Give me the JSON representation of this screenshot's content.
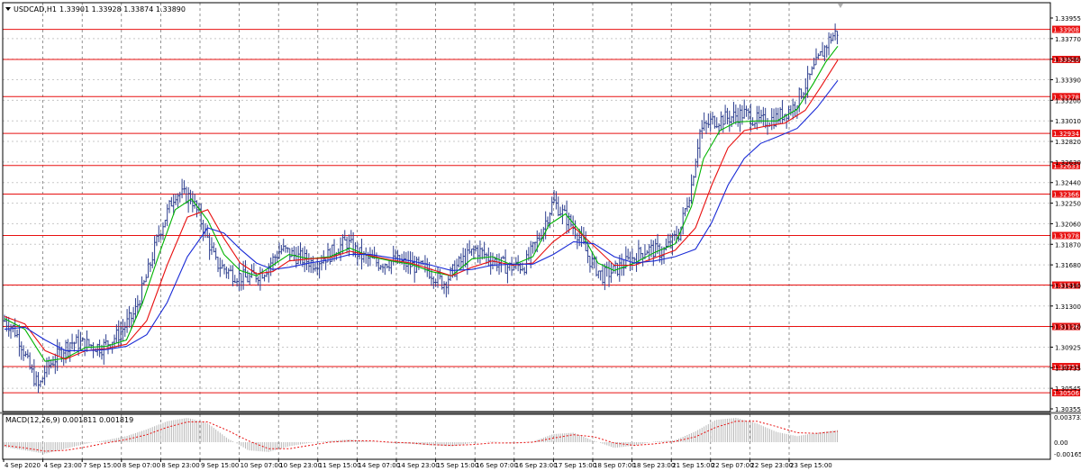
{
  "header": {
    "symbol_label": "USDCAD,H1",
    "ohlc_label": "1.33901 1.33928 1.33874 1.33890"
  },
  "macd": {
    "label": "MACD(12,26,9) 0.001811 0.001819",
    "scale_labels": [
      "0.003732",
      "0.00",
      "-0.001652"
    ]
  },
  "colors": {
    "background": "#ffffff",
    "frame": "#000000",
    "grid": "#c8c8c8",
    "candles": "#2e3f8f",
    "ma_fast": "#00b400",
    "ma_mid": "#e81010",
    "ma_slow": "#1a2bd6",
    "level_line": "#e81010",
    "level_tag_bg": "#e81010",
    "level_tag_text": "#ffffff",
    "macd_hist": "#b8b8b8",
    "macd_signal": "#e81010"
  },
  "chart_data": {
    "type": "line",
    "title": "USDCAD,H1",
    "y_ticks": [
      "1.33955",
      "1.33770",
      "1.33580",
      "1.33390",
      "1.33200",
      "1.33010",
      "1.32820",
      "1.32630",
      "1.32440",
      "1.32250",
      "1.32060",
      "1.31870",
      "1.31680",
      "1.31490",
      "1.31300",
      "1.31110",
      "1.30925",
      "1.30735",
      "1.30545",
      "1.30355"
    ],
    "x_ticks": [
      "4 Sep 2020",
      "4 Sep 23:00",
      "7 Sep 15:00",
      "8 Sep 07:00",
      "8 Sep 23:00",
      "9 Sep 15:00",
      "10 Sep 07:00",
      "10 Sep 23:00",
      "11 Sep 15:00",
      "14 Sep 07:00",
      "14 Sep 23:00",
      "15 Sep 15:00",
      "16 Sep 07:00",
      "16 Sep 23:00",
      "17 Sep 15:00",
      "18 Sep 07:00",
      "18 Sep 23:00",
      "21 Sep 15:00",
      "22 Sep 07:00",
      "22 Sep 23:00",
      "23 Sep 15:00"
    ],
    "ylim": [
      1.30355,
      1.33955
    ],
    "x_range": [
      0,
      20.5
    ],
    "grid": true,
    "levels": [
      "1.33908",
      "1.33626",
      "1.33278",
      "1.32934",
      "1.32633",
      "1.32366",
      "1.31978",
      "1.31514",
      "1.31126",
      "1.30751",
      "1.30506"
    ],
    "price_series": [
      {
        "x": 0.0,
        "y": 1.3118
      },
      {
        "x": 0.2,
        "y": 1.3112
      },
      {
        "x": 0.4,
        "y": 1.3098
      },
      {
        "x": 0.6,
        "y": 1.3075
      },
      {
        "x": 0.85,
        "y": 1.3055
      },
      {
        "x": 1.0,
        "y": 1.3072
      },
      {
        "x": 1.3,
        "y": 1.3085
      },
      {
        "x": 1.6,
        "y": 1.3098
      },
      {
        "x": 2.0,
        "y": 1.3096
      },
      {
        "x": 2.4,
        "y": 1.3093
      },
      {
        "x": 2.8,
        "y": 1.3105
      },
      {
        "x": 3.2,
        "y": 1.3125
      },
      {
        "x": 3.5,
        "y": 1.316
      },
      {
        "x": 3.8,
        "y": 1.32
      },
      {
        "x": 4.2,
        "y": 1.3238
      },
      {
        "x": 4.6,
        "y": 1.3233
      },
      {
        "x": 4.9,
        "y": 1.3205
      },
      {
        "x": 5.2,
        "y": 1.3172
      },
      {
        "x": 5.6,
        "y": 1.3162
      },
      {
        "x": 6.0,
        "y": 1.3157
      },
      {
        "x": 6.4,
        "y": 1.3165
      },
      {
        "x": 6.8,
        "y": 1.3185
      },
      {
        "x": 7.2,
        "y": 1.3178
      },
      {
        "x": 7.6,
        "y": 1.3172
      },
      {
        "x": 8.0,
        "y": 1.318
      },
      {
        "x": 8.4,
        "y": 1.3192
      },
      {
        "x": 8.8,
        "y": 1.3178
      },
      {
        "x": 9.2,
        "y": 1.3172
      },
      {
        "x": 9.6,
        "y": 1.3174
      },
      {
        "x": 10.0,
        "y": 1.317
      },
      {
        "x": 10.4,
        "y": 1.3166
      },
      {
        "x": 10.8,
        "y": 1.3153
      },
      {
        "x": 11.2,
        "y": 1.3172
      },
      {
        "x": 11.6,
        "y": 1.3185
      },
      {
        "x": 12.0,
        "y": 1.3175
      },
      {
        "x": 12.4,
        "y": 1.3168
      },
      {
        "x": 12.8,
        "y": 1.317
      },
      {
        "x": 13.2,
        "y": 1.32
      },
      {
        "x": 13.5,
        "y": 1.323
      },
      {
        "x": 13.8,
        "y": 1.3215
      },
      {
        "x": 14.1,
        "y": 1.32
      },
      {
        "x": 14.4,
        "y": 1.3175
      },
      {
        "x": 14.7,
        "y": 1.316
      },
      {
        "x": 15.0,
        "y": 1.3165
      },
      {
        "x": 15.4,
        "y": 1.3175
      },
      {
        "x": 15.8,
        "y": 1.3185
      },
      {
        "x": 16.2,
        "y": 1.3182
      },
      {
        "x": 16.6,
        "y": 1.32
      },
      {
        "x": 16.9,
        "y": 1.3245
      },
      {
        "x": 17.1,
        "y": 1.3295
      },
      {
        "x": 17.4,
        "y": 1.3305
      },
      {
        "x": 17.8,
        "y": 1.3308
      },
      {
        "x": 18.2,
        "y": 1.3312
      },
      {
        "x": 18.6,
        "y": 1.3304
      },
      {
        "x": 19.0,
        "y": 1.3308
      },
      {
        "x": 19.4,
        "y": 1.3318
      },
      {
        "x": 19.8,
        "y": 1.3345
      },
      {
        "x": 20.1,
        "y": 1.3368
      },
      {
        "x": 20.3,
        "y": 1.3382
      },
      {
        "x": 20.5,
        "y": 1.3389
      }
    ],
    "moving_averages": [
      {
        "color_key": "ma_fast",
        "values": [
          {
            "x": 0.0,
            "y": 1.312
          },
          {
            "x": 0.5,
            "y": 1.311
          },
          {
            "x": 1.0,
            "y": 1.308
          },
          {
            "x": 1.5,
            "y": 1.3083
          },
          {
            "x": 2.0,
            "y": 1.3093
          },
          {
            "x": 2.5,
            "y": 1.3094
          },
          {
            "x": 3.0,
            "y": 1.31
          },
          {
            "x": 3.4,
            "y": 1.3135
          },
          {
            "x": 3.8,
            "y": 1.318
          },
          {
            "x": 4.2,
            "y": 1.3222
          },
          {
            "x": 4.6,
            "y": 1.3232
          },
          {
            "x": 5.0,
            "y": 1.3212
          },
          {
            "x": 5.4,
            "y": 1.318
          },
          {
            "x": 5.8,
            "y": 1.3165
          },
          {
            "x": 6.2,
            "y": 1.316
          },
          {
            "x": 6.6,
            "y": 1.317
          },
          {
            "x": 7.0,
            "y": 1.318
          },
          {
            "x": 7.5,
            "y": 1.3176
          },
          {
            "x": 8.0,
            "y": 1.3178
          },
          {
            "x": 8.5,
            "y": 1.3186
          },
          {
            "x": 9.0,
            "y": 1.3178
          },
          {
            "x": 9.5,
            "y": 1.3174
          },
          {
            "x": 10.0,
            "y": 1.3171
          },
          {
            "x": 10.5,
            "y": 1.3164
          },
          {
            "x": 11.0,
            "y": 1.316
          },
          {
            "x": 11.5,
            "y": 1.3176
          },
          {
            "x": 12.0,
            "y": 1.3178
          },
          {
            "x": 12.5,
            "y": 1.317
          },
          {
            "x": 13.0,
            "y": 1.3178
          },
          {
            "x": 13.4,
            "y": 1.3208
          },
          {
            "x": 13.8,
            "y": 1.3218
          },
          {
            "x": 14.2,
            "y": 1.32
          },
          {
            "x": 14.6,
            "y": 1.3172
          },
          {
            "x": 15.0,
            "y": 1.3165
          },
          {
            "x": 15.5,
            "y": 1.3172
          },
          {
            "x": 16.0,
            "y": 1.3182
          },
          {
            "x": 16.5,
            "y": 1.319
          },
          {
            "x": 16.9,
            "y": 1.3225
          },
          {
            "x": 17.2,
            "y": 1.327
          },
          {
            "x": 17.6,
            "y": 1.3296
          },
          {
            "x": 18.0,
            "y": 1.3304
          },
          {
            "x": 18.5,
            "y": 1.3305
          },
          {
            "x": 19.0,
            "y": 1.3305
          },
          {
            "x": 19.5,
            "y": 1.3316
          },
          {
            "x": 19.9,
            "y": 1.334
          },
          {
            "x": 20.2,
            "y": 1.336
          },
          {
            "x": 20.5,
            "y": 1.3375
          }
        ]
      },
      {
        "color_key": "ma_mid",
        "values": [
          {
            "x": 0.0,
            "y": 1.3122
          },
          {
            "x": 0.5,
            "y": 1.3115
          },
          {
            "x": 1.0,
            "y": 1.309
          },
          {
            "x": 1.5,
            "y": 1.3082
          },
          {
            "x": 2.0,
            "y": 1.309
          },
          {
            "x": 2.5,
            "y": 1.3092
          },
          {
            "x": 3.0,
            "y": 1.3096
          },
          {
            "x": 3.5,
            "y": 1.3118
          },
          {
            "x": 4.0,
            "y": 1.317
          },
          {
            "x": 4.5,
            "y": 1.3215
          },
          {
            "x": 5.0,
            "y": 1.3222
          },
          {
            "x": 5.4,
            "y": 1.3195
          },
          {
            "x": 5.8,
            "y": 1.3172
          },
          {
            "x": 6.2,
            "y": 1.3162
          },
          {
            "x": 6.6,
            "y": 1.3164
          },
          {
            "x": 7.0,
            "y": 1.3174
          },
          {
            "x": 7.5,
            "y": 1.3176
          },
          {
            "x": 8.0,
            "y": 1.3177
          },
          {
            "x": 8.5,
            "y": 1.3183
          },
          {
            "x": 9.0,
            "y": 1.3179
          },
          {
            "x": 9.5,
            "y": 1.3175
          },
          {
            "x": 10.0,
            "y": 1.3172
          },
          {
            "x": 10.5,
            "y": 1.3166
          },
          {
            "x": 11.0,
            "y": 1.316
          },
          {
            "x": 11.5,
            "y": 1.3168
          },
          {
            "x": 12.0,
            "y": 1.3174
          },
          {
            "x": 12.5,
            "y": 1.317
          },
          {
            "x": 13.0,
            "y": 1.3172
          },
          {
            "x": 13.5,
            "y": 1.3192
          },
          {
            "x": 14.0,
            "y": 1.3206
          },
          {
            "x": 14.5,
            "y": 1.3188
          },
          {
            "x": 15.0,
            "y": 1.317
          },
          {
            "x": 15.5,
            "y": 1.317
          },
          {
            "x": 16.0,
            "y": 1.3177
          },
          {
            "x": 16.5,
            "y": 1.3184
          },
          {
            "x": 17.0,
            "y": 1.3205
          },
          {
            "x": 17.4,
            "y": 1.3245
          },
          {
            "x": 17.8,
            "y": 1.328
          },
          {
            "x": 18.2,
            "y": 1.3296
          },
          {
            "x": 18.7,
            "y": 1.33
          },
          {
            "x": 19.2,
            "y": 1.3303
          },
          {
            "x": 19.7,
            "y": 1.3315
          },
          {
            "x": 20.1,
            "y": 1.3338
          },
          {
            "x": 20.5,
            "y": 1.3362
          }
        ]
      },
      {
        "color_key": "ma_slow",
        "values": [
          {
            "x": 0.0,
            "y": 1.311
          },
          {
            "x": 0.5,
            "y": 1.3112
          },
          {
            "x": 1.0,
            "y": 1.31
          },
          {
            "x": 1.5,
            "y": 1.309
          },
          {
            "x": 2.0,
            "y": 1.309
          },
          {
            "x": 2.5,
            "y": 1.3091
          },
          {
            "x": 3.0,
            "y": 1.3094
          },
          {
            "x": 3.5,
            "y": 1.3105
          },
          {
            "x": 4.0,
            "y": 1.3135
          },
          {
            "x": 4.5,
            "y": 1.3178
          },
          {
            "x": 5.0,
            "y": 1.3205
          },
          {
            "x": 5.4,
            "y": 1.32
          },
          {
            "x": 5.8,
            "y": 1.3185
          },
          {
            "x": 6.2,
            "y": 1.3172
          },
          {
            "x": 6.6,
            "y": 1.3166
          },
          {
            "x": 7.0,
            "y": 1.3168
          },
          {
            "x": 7.5,
            "y": 1.3172
          },
          {
            "x": 8.0,
            "y": 1.3175
          },
          {
            "x": 8.5,
            "y": 1.318
          },
          {
            "x": 9.0,
            "y": 1.318
          },
          {
            "x": 9.5,
            "y": 1.3177
          },
          {
            "x": 10.0,
            "y": 1.3174
          },
          {
            "x": 10.5,
            "y": 1.317
          },
          {
            "x": 11.0,
            "y": 1.3165
          },
          {
            "x": 11.5,
            "y": 1.3166
          },
          {
            "x": 12.0,
            "y": 1.317
          },
          {
            "x": 12.5,
            "y": 1.3171
          },
          {
            "x": 13.0,
            "y": 1.3171
          },
          {
            "x": 13.5,
            "y": 1.318
          },
          {
            "x": 14.0,
            "y": 1.3192
          },
          {
            "x": 14.5,
            "y": 1.319
          },
          {
            "x": 15.0,
            "y": 1.3178
          },
          {
            "x": 15.5,
            "y": 1.3172
          },
          {
            "x": 16.0,
            "y": 1.3174
          },
          {
            "x": 16.5,
            "y": 1.3178
          },
          {
            "x": 17.0,
            "y": 1.3185
          },
          {
            "x": 17.4,
            "y": 1.321
          },
          {
            "x": 17.8,
            "y": 1.3245
          },
          {
            "x": 18.2,
            "y": 1.327
          },
          {
            "x": 18.6,
            "y": 1.3284
          },
          {
            "x": 19.0,
            "y": 1.329
          },
          {
            "x": 19.5,
            "y": 1.3298
          },
          {
            "x": 20.0,
            "y": 1.3318
          },
          {
            "x": 20.5,
            "y": 1.3343
          }
        ]
      }
    ],
    "macd_hist": [
      {
        "x": 0.0,
        "y": -0.0006
      },
      {
        "x": 0.5,
        "y": -0.001
      },
      {
        "x": 1.0,
        "y": -0.0014
      },
      {
        "x": 1.5,
        "y": -0.0008
      },
      {
        "x": 2.0,
        "y": -0.0002
      },
      {
        "x": 2.5,
        "y": 0.0003
      },
      {
        "x": 3.0,
        "y": 0.0009
      },
      {
        "x": 3.5,
        "y": 0.0019
      },
      {
        "x": 4.0,
        "y": 0.0031
      },
      {
        "x": 4.5,
        "y": 0.0036
      },
      {
        "x": 5.0,
        "y": 0.0028
      },
      {
        "x": 5.5,
        "y": 0.0005
      },
      {
        "x": 6.0,
        "y": -0.001
      },
      {
        "x": 6.5,
        "y": -0.0012
      },
      {
        "x": 7.0,
        "y": -0.0005
      },
      {
        "x": 7.5,
        "y": -0.0001
      },
      {
        "x": 8.0,
        "y": 0.0002
      },
      {
        "x": 8.5,
        "y": 0.0004
      },
      {
        "x": 9.0,
        "y": 0.0001
      },
      {
        "x": 9.5,
        "y": -0.0001
      },
      {
        "x": 10.0,
        "y": -0.0002
      },
      {
        "x": 10.5,
        "y": -0.0004
      },
      {
        "x": 11.0,
        "y": -0.0005
      },
      {
        "x": 11.5,
        "y": -0.0001
      },
      {
        "x": 12.0,
        "y": 0.0001
      },
      {
        "x": 12.5,
        "y": -0.0001
      },
      {
        "x": 13.0,
        "y": 0.0001
      },
      {
        "x": 13.5,
        "y": 0.0012
      },
      {
        "x": 14.0,
        "y": 0.0014
      },
      {
        "x": 14.5,
        "y": 0.0002
      },
      {
        "x": 15.0,
        "y": -0.0007
      },
      {
        "x": 15.5,
        "y": -0.0004
      },
      {
        "x": 16.0,
        "y": 0.0001
      },
      {
        "x": 16.5,
        "y": 0.0003
      },
      {
        "x": 17.0,
        "y": 0.0016
      },
      {
        "x": 17.5,
        "y": 0.0033
      },
      {
        "x": 18.0,
        "y": 0.0036
      },
      {
        "x": 18.5,
        "y": 0.0028
      },
      {
        "x": 19.0,
        "y": 0.0015
      },
      {
        "x": 19.5,
        "y": 0.0009
      },
      {
        "x": 20.0,
        "y": 0.0014
      },
      {
        "x": 20.5,
        "y": 0.0018
      }
    ],
    "macd_signal": [
      {
        "x": 0.0,
        "y": -0.0004
      },
      {
        "x": 0.5,
        "y": -0.0007
      },
      {
        "x": 1.0,
        "y": -0.0011
      },
      {
        "x": 1.5,
        "y": -0.001
      },
      {
        "x": 2.0,
        "y": -0.0006
      },
      {
        "x": 2.5,
        "y": -0.0001
      },
      {
        "x": 3.0,
        "y": 0.0004
      },
      {
        "x": 3.5,
        "y": 0.0011
      },
      {
        "x": 4.0,
        "y": 0.0022
      },
      {
        "x": 4.5,
        "y": 0.003
      },
      {
        "x": 5.0,
        "y": 0.003
      },
      {
        "x": 5.5,
        "y": 0.0017
      },
      {
        "x": 6.0,
        "y": 0.0002
      },
      {
        "x": 6.5,
        "y": -0.0008
      },
      {
        "x": 7.0,
        "y": -0.0008
      },
      {
        "x": 7.5,
        "y": -0.0004
      },
      {
        "x": 8.0,
        "y": 0.0
      },
      {
        "x": 8.5,
        "y": 0.0002
      },
      {
        "x": 9.0,
        "y": 0.0002
      },
      {
        "x": 9.5,
        "y": 0.0
      },
      {
        "x": 10.0,
        "y": -0.0001
      },
      {
        "x": 10.5,
        "y": -0.0003
      },
      {
        "x": 11.0,
        "y": -0.0004
      },
      {
        "x": 11.5,
        "y": -0.0003
      },
      {
        "x": 12.0,
        "y": -0.0001
      },
      {
        "x": 12.5,
        "y": -0.0001
      },
      {
        "x": 13.0,
        "y": 0.0
      },
      {
        "x": 13.5,
        "y": 0.0006
      },
      {
        "x": 14.0,
        "y": 0.0011
      },
      {
        "x": 14.5,
        "y": 0.0008
      },
      {
        "x": 15.0,
        "y": -0.0001
      },
      {
        "x": 15.5,
        "y": -0.0004
      },
      {
        "x": 16.0,
        "y": -0.0002
      },
      {
        "x": 16.5,
        "y": 0.0001
      },
      {
        "x": 17.0,
        "y": 0.0008
      },
      {
        "x": 17.5,
        "y": 0.0022
      },
      {
        "x": 18.0,
        "y": 0.0031
      },
      {
        "x": 18.5,
        "y": 0.0031
      },
      {
        "x": 19.0,
        "y": 0.0023
      },
      {
        "x": 19.5,
        "y": 0.0014
      },
      {
        "x": 20.0,
        "y": 0.0013
      },
      {
        "x": 20.5,
        "y": 0.0016
      }
    ]
  }
}
